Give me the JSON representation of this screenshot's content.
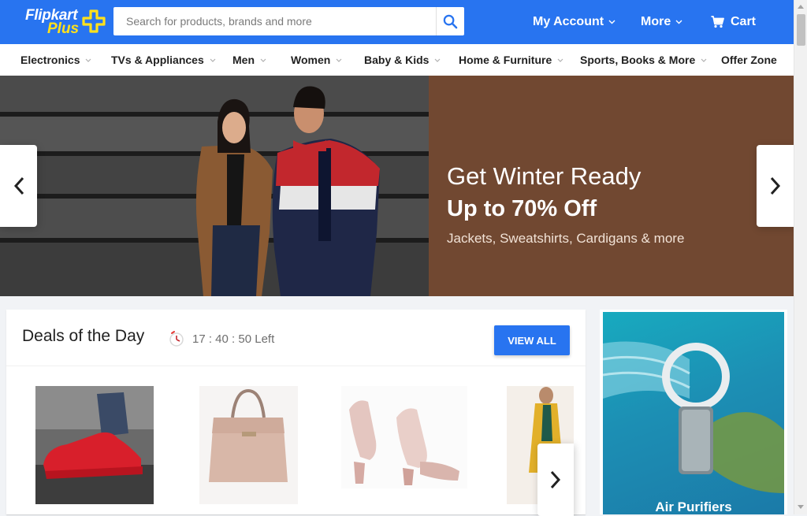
{
  "brand": {
    "name": "Flipkart",
    "tier": "Plus"
  },
  "search": {
    "placeholder": "Search for products, brands and more"
  },
  "nav": {
    "account": "My Account",
    "more": "More",
    "cart": "Cart"
  },
  "categories": [
    "Electronics",
    "TVs & Appliances",
    "Men",
    "Women",
    "Baby & Kids",
    "Home & Furniture",
    "Sports, Books & More",
    "Offer Zone"
  ],
  "banner": {
    "line1": "Get Winter Ready",
    "line2": "Up to 70% Off",
    "line3": "Jackets, Sweatshirts, Cardigans & more"
  },
  "deals": {
    "title": "Deals of the Day",
    "timer": "17 : 40 : 50 Left",
    "view_all": "VIEW ALL"
  },
  "products": [
    "red-suede-sneakers",
    "beige-handbag",
    "pink-block-heel-sandals",
    "yellow-kurta"
  ],
  "ad": {
    "label": "Air Purifiers"
  },
  "colors": {
    "brand_blue": "#2874f0",
    "plus_yellow": "#ffe11b",
    "banner_brown": "#714831",
    "ad_teal": "#1c8fb4"
  }
}
